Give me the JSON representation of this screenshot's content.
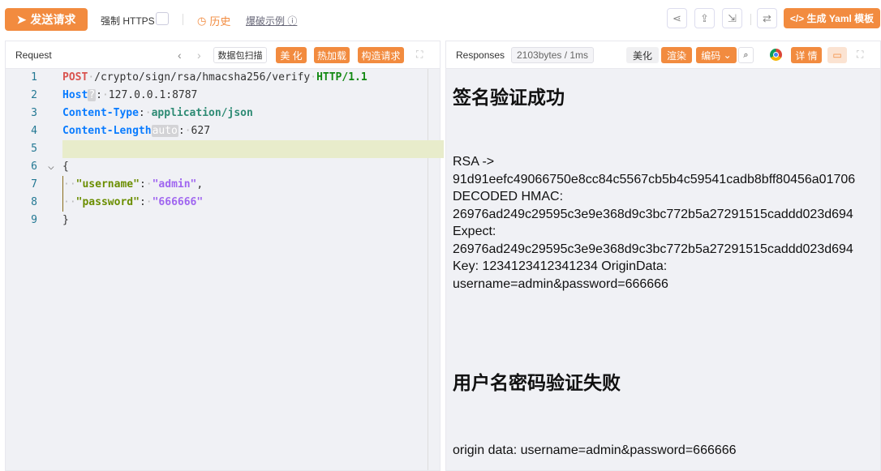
{
  "toolbar": {
    "send": "发送请求",
    "https": "强制 HTTPS",
    "history": "历史",
    "example": "爆破示例",
    "yaml": "</> 生成 Yaml 模板"
  },
  "request": {
    "title": "Request",
    "scan": "数据包扫描",
    "beautify": "美 化",
    "hotload": "热加载",
    "construct": "构造请求",
    "lines": [
      {
        "n": "1"
      },
      {
        "n": "2"
      },
      {
        "n": "3"
      },
      {
        "n": "4"
      },
      {
        "n": "5"
      },
      {
        "n": "6"
      },
      {
        "n": "7"
      },
      {
        "n": "8"
      },
      {
        "n": "9"
      }
    ],
    "method": "POST",
    "path": "/crypto/sign/rsa/hmacsha256/verify",
    "proto": "HTTP/1.1",
    "host_key": "Host",
    "host_tag": "?",
    "host_val": "127.0.0.1:8787",
    "ct_key": "Content-Type",
    "ct_val": "application/json",
    "cl_key": "Content-Length",
    "cl_tag": "auto",
    "cl_val": "627",
    "open": "{",
    "close": "}",
    "u_key": "\"username\"",
    "u_val": "\"admin\"",
    "p_key": "\"password\"",
    "p_val": "\"666666\""
  },
  "response": {
    "title": "Responses",
    "meta": "2103bytes / 1ms",
    "beautify": "美化",
    "render": "渲染",
    "encode": "编码",
    "detail": "详 情",
    "h1": "签名验证成功",
    "body": [
      "RSA ->",
      "91d91eefc49066750e8cc84c5567cb5b4c59541cadb8bff80456a01706",
      "DECODED HMAC:",
      "26976ad249c29595c3e9e368d9c3bc772b5a27291515caddd023d694",
      "Expect:",
      "26976ad249c29595c3e9e368d9c3bc772b5a27291515caddd023d694",
      "Key: 1234123412341234 OriginData:",
      "username=admin&password=666666"
    ],
    "h2": "用户名密码验证失败",
    "body2": "origin data: username=admin&password=666666"
  },
  "colors": {
    "accent": "#f28b3f"
  }
}
